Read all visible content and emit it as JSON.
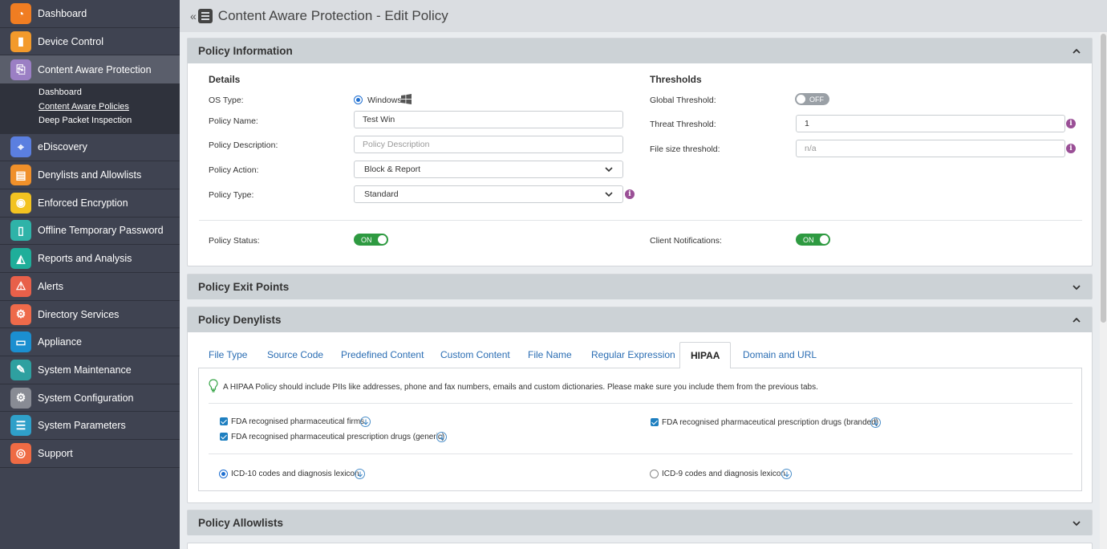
{
  "sidebar": {
    "items": [
      {
        "label": "Dashboard",
        "icon": "dashboard-icon",
        "color": "#f07d22",
        "glyph": "◔"
      },
      {
        "label": "Device Control",
        "icon": "device-control-icon",
        "color": "#f39a2b",
        "glyph": "▮"
      },
      {
        "label": "Content Aware Protection",
        "icon": "content-aware-icon",
        "color": "#9b7fc4",
        "glyph": "⎘"
      },
      {
        "label": "eDiscovery",
        "icon": "ediscovery-icon",
        "color": "#5b7fe0",
        "glyph": "⌖"
      },
      {
        "label": "Denylists and Allowlists",
        "icon": "denylists-icon",
        "color": "#f0902a",
        "glyph": "▤"
      },
      {
        "label": "Enforced Encryption",
        "icon": "encryption-icon",
        "color": "#f3c321",
        "glyph": "◉"
      },
      {
        "label": "Offline Temporary Password",
        "icon": "offline-password-icon",
        "color": "#2fb3a8",
        "glyph": "▯"
      },
      {
        "label": "Reports and Analysis",
        "icon": "reports-icon",
        "color": "#1fae9a",
        "glyph": "◭"
      },
      {
        "label": "Alerts",
        "icon": "alerts-icon",
        "color": "#e8604a",
        "glyph": "⚠"
      },
      {
        "label": "Directory Services",
        "icon": "directory-icon",
        "color": "#ee6a4a",
        "glyph": "⚙"
      },
      {
        "label": "Appliance",
        "icon": "appliance-icon",
        "color": "#1b8fd0",
        "glyph": "▭"
      },
      {
        "label": "System Maintenance",
        "icon": "maintenance-icon",
        "color": "#2ea0a0",
        "glyph": "✎"
      },
      {
        "label": "System Configuration",
        "icon": "configuration-icon",
        "color": "#888b94",
        "glyph": "⚙"
      },
      {
        "label": "System Parameters",
        "icon": "parameters-icon",
        "color": "#2fa0c9",
        "glyph": "☰"
      },
      {
        "label": "Support",
        "icon": "support-icon",
        "color": "#ef6b44",
        "glyph": "◎"
      }
    ],
    "submenu": [
      "Dashboard",
      "Content Aware Policies",
      "Deep Packet Inspection"
    ]
  },
  "header": {
    "title": "Content Aware Protection - Edit Policy"
  },
  "policy_info": {
    "title": "Policy Information",
    "details_title": "Details",
    "thresholds_title": "Thresholds",
    "os_type_label": "OS Type:",
    "os_type_value": "Windows",
    "policy_name_label": "Policy Name:",
    "policy_name_value": "Test Win",
    "policy_desc_label": "Policy Description:",
    "policy_desc_placeholder": "Policy Description",
    "policy_action_label": "Policy Action:",
    "policy_action_value": "Block & Report",
    "policy_type_label": "Policy Type:",
    "policy_type_value": "Standard",
    "global_threshold_label": "Global Threshold:",
    "global_threshold_state": "OFF",
    "threat_threshold_label": "Threat Threshold:",
    "threat_threshold_value": "1",
    "file_size_threshold_label": "File size threshold:",
    "file_size_threshold_placeholder": "n/a",
    "policy_status_label": "Policy Status:",
    "policy_status_state": "ON",
    "client_notifications_label": "Client Notifications:",
    "client_notifications_state": "ON"
  },
  "exit_points": {
    "title": "Policy Exit Points"
  },
  "denylists": {
    "title": "Policy Denylists",
    "tabs": [
      "File Type",
      "Source Code",
      "Predefined Content",
      "Custom Content",
      "File Name",
      "Regular Expression",
      "HIPAA",
      "Domain and URL"
    ],
    "active_tab": "HIPAA",
    "hint": "A HIPAA Policy should include PIIs like addresses, phone and fax numbers, emails and custom dictionaries. Please make sure you include them from the previous tabs.",
    "checkbox_1": "FDA recognised pharmaceutical firms",
    "checkbox_2": "FDA recognised pharmaceutical prescription drugs (generic)",
    "checkbox_3": "FDA recognised pharmaceutical prescription drugs (branded)",
    "radio_1": "ICD-10 codes and diagnosis lexicon",
    "radio_2": "ICD-9 codes and diagnosis lexicon"
  },
  "allowlists": {
    "title": "Policy Allowlists"
  }
}
